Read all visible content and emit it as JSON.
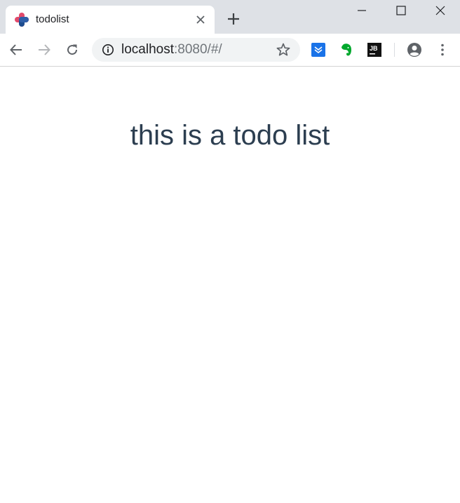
{
  "browser": {
    "tab": {
      "title": "todolist"
    },
    "address": {
      "host": "localhost",
      "rest": ":8080/#/"
    }
  },
  "page": {
    "heading": "this is a todo list"
  },
  "colors": {
    "heading": "#2c3e50",
    "tabstrip": "#dee1e6",
    "omnibox": "#f1f3f4",
    "ext_blue": "#1a73e8",
    "ext_green": "#00a82d"
  },
  "icons": [
    "favicon-icon",
    "close-icon",
    "plus-icon",
    "minimize-icon",
    "maximize-icon",
    "window-close-icon",
    "back-arrow-icon",
    "forward-arrow-icon",
    "reload-icon",
    "info-icon",
    "star-icon",
    "extension-download-icon",
    "evernote-icon",
    "jetbrains-icon",
    "profile-icon",
    "menu-dots-icon"
  ]
}
